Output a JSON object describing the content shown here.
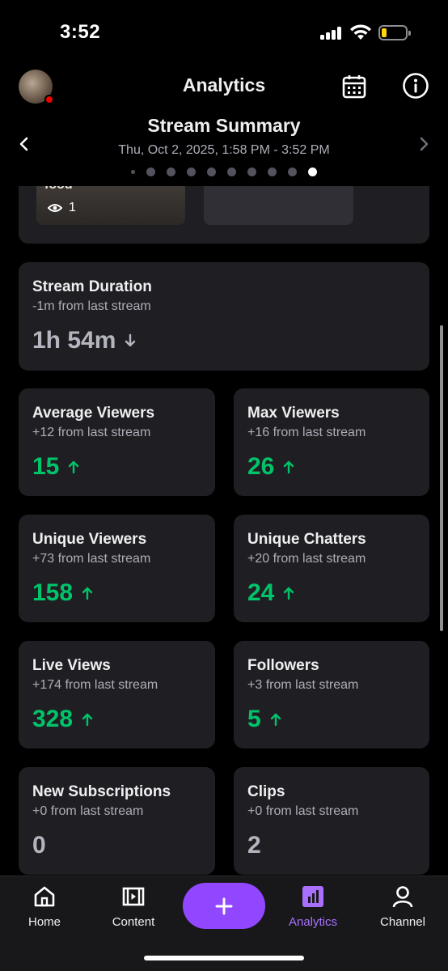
{
  "status": {
    "time": "3:52"
  },
  "header": {
    "title": "Analytics",
    "summary_title": "Stream Summary",
    "summary_date": "Thu, Oct 2, 2025, 1:58 PM - 3:52 PM"
  },
  "pager": {
    "total": 10,
    "active_index": 9
  },
  "clip": {
    "title": "food",
    "views": "1"
  },
  "stats": {
    "duration": {
      "title": "Stream Duration",
      "sub": "-1m from last stream",
      "value": "1h 54m",
      "trend": "down"
    },
    "avg_viewers": {
      "title": "Average Viewers",
      "sub": "+12 from last stream",
      "value": "15",
      "trend": "up"
    },
    "max_viewers": {
      "title": "Max Viewers",
      "sub": "+16 from last stream",
      "value": "26",
      "trend": "up"
    },
    "unique_viewers": {
      "title": "Unique Viewers",
      "sub": "+73 from last stream",
      "value": "158",
      "trend": "up"
    },
    "unique_chatters": {
      "title": "Unique Chatters",
      "sub": "+20 from last stream",
      "value": "24",
      "trend": "up"
    },
    "live_views": {
      "title": "Live Views",
      "sub": "+174 from last stream",
      "value": "328",
      "trend": "up"
    },
    "followers": {
      "title": "Followers",
      "sub": "+3 from last stream",
      "value": "5",
      "trend": "up"
    },
    "new_subs": {
      "title": "New Subscriptions",
      "sub": "+0 from last stream",
      "value": "0",
      "trend": "none"
    },
    "clips": {
      "title": "Clips",
      "sub": "+0 from last stream",
      "value": "2",
      "trend": "none"
    }
  },
  "nav": {
    "home": "Home",
    "content": "Content",
    "analytics": "Analytics",
    "channel": "Channel",
    "active": "analytics"
  },
  "colors": {
    "accent": "#9147ff",
    "accent_text": "#a970ff",
    "positive": "#00c46a",
    "card": "#1f1f23",
    "live_dot": "#eb0400"
  },
  "icons": [
    "calendar-icon",
    "info-icon",
    "chevron-left-icon",
    "chevron-right-icon",
    "eye-icon",
    "arrow-up-icon",
    "arrow-down-icon",
    "home-icon",
    "content-icon",
    "plus-icon",
    "analytics-icon",
    "channel-icon"
  ]
}
